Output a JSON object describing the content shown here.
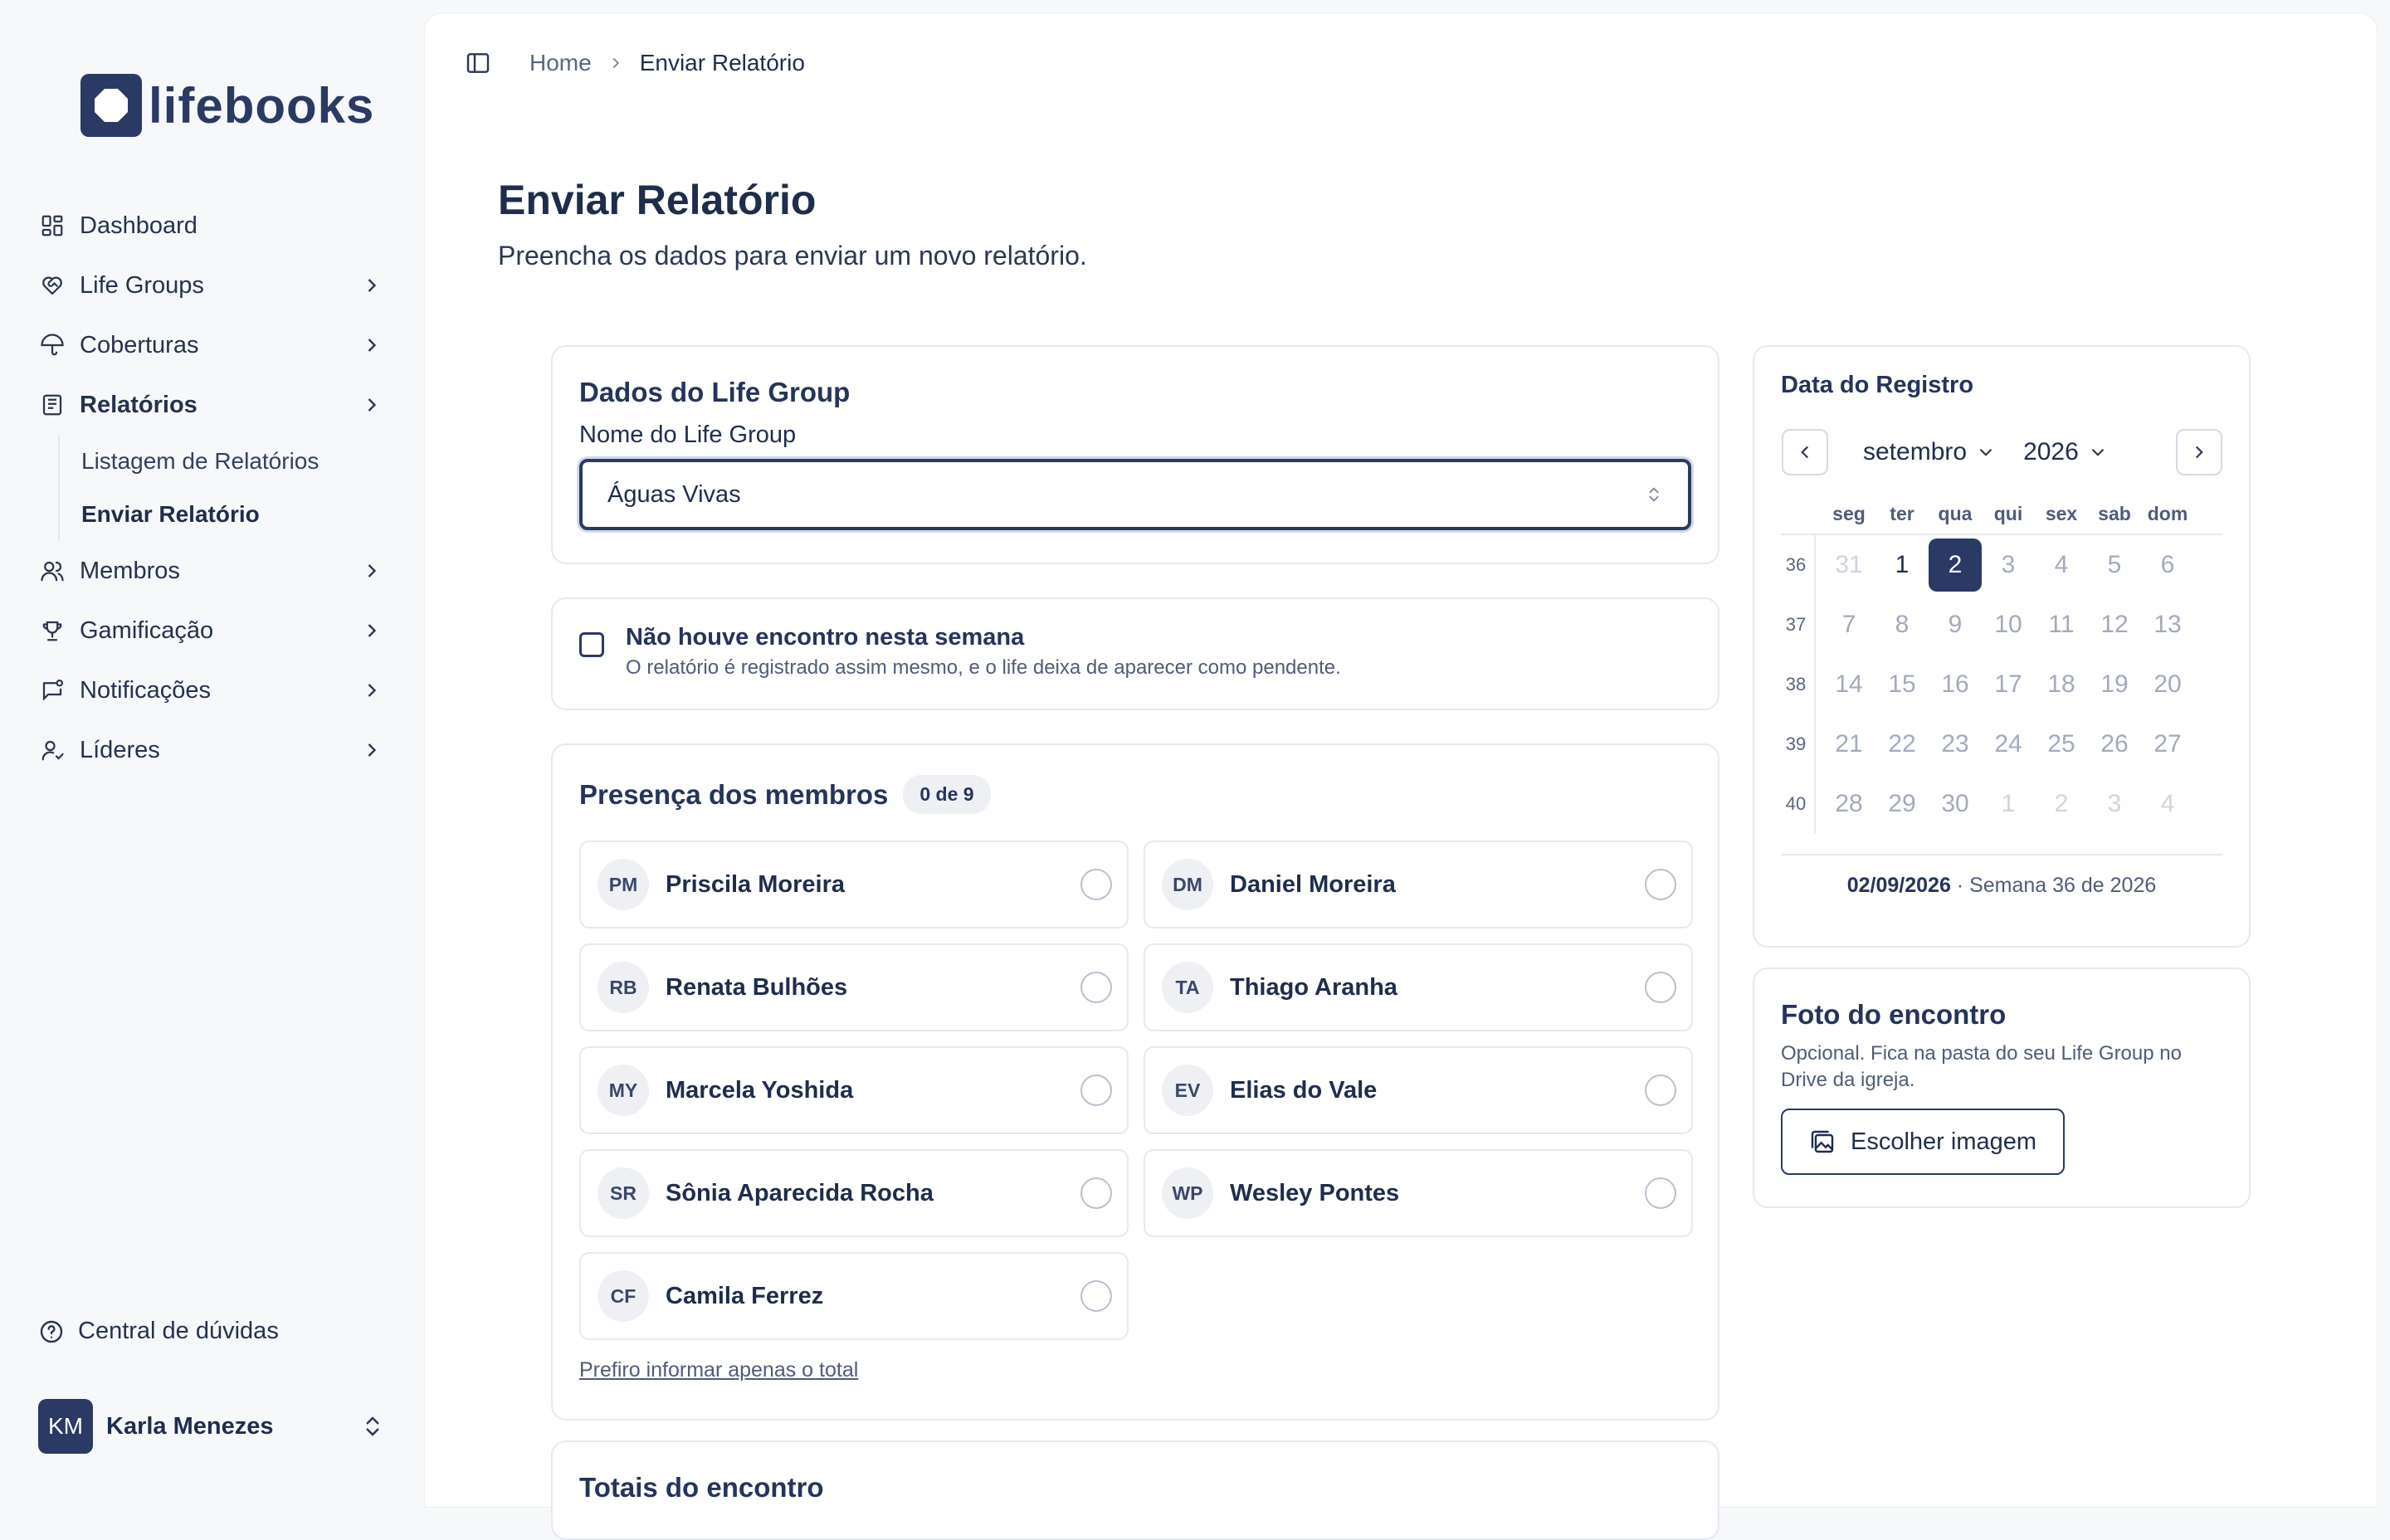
{
  "brand": {
    "name": "lifebooks"
  },
  "sidebar": {
    "items": [
      {
        "label": "Dashboard",
        "icon": "dashboard-icon",
        "chevron": false
      },
      {
        "label": "Life Groups",
        "icon": "heart-handshake-icon",
        "chevron": true
      },
      {
        "label": "Coberturas",
        "icon": "umbrella-icon",
        "chevron": true
      },
      {
        "label": "Relatórios",
        "icon": "report-icon",
        "chevron": true,
        "active": true
      },
      {
        "label": "Membros",
        "icon": "users-icon",
        "chevron": true
      },
      {
        "label": "Gamificação",
        "icon": "trophy-icon",
        "chevron": true
      },
      {
        "label": "Notificações",
        "icon": "notification-icon",
        "chevron": true
      },
      {
        "label": "Líderes",
        "icon": "leader-icon",
        "chevron": true
      }
    ],
    "subitems": [
      {
        "label": "Listagem de Relatórios"
      },
      {
        "label": "Enviar Relatório",
        "active": true
      }
    ],
    "help": "Central de dúvidas",
    "user": {
      "initials": "KM",
      "name": "Karla Menezes"
    }
  },
  "breadcrumb": {
    "home": "Home",
    "current": "Enviar Relatório"
  },
  "page": {
    "title": "Enviar Relatório",
    "subtitle": "Preencha os dados para enviar um novo relatório."
  },
  "lifegroup": {
    "title": "Dados do Life Group",
    "field_label": "Nome do Life Group",
    "selected": "Águas Vivas"
  },
  "no_meeting": {
    "title": "Não houve encontro nesta semana",
    "description": "O relatório é registrado assim mesmo, e o life deixa de aparecer como pendente.",
    "checked": false
  },
  "presence": {
    "title": "Presença dos membros",
    "count": "0 de 9",
    "members": [
      {
        "initials": "PM",
        "name": "Priscila Moreira"
      },
      {
        "initials": "DM",
        "name": "Daniel Moreira"
      },
      {
        "initials": "RB",
        "name": "Renata Bulhões"
      },
      {
        "initials": "TA",
        "name": "Thiago Aranha"
      },
      {
        "initials": "MY",
        "name": "Marcela Yoshida"
      },
      {
        "initials": "EV",
        "name": "Elias do Vale"
      },
      {
        "initials": "SR",
        "name": "Sônia Aparecida Rocha"
      },
      {
        "initials": "WP",
        "name": "Wesley Pontes"
      },
      {
        "initials": "CF",
        "name": "Camila Ferrez"
      }
    ],
    "total_link": "Prefiro informar apenas o total"
  },
  "totals": {
    "title": "Totais do encontro"
  },
  "calendar": {
    "title": "Data do Registro",
    "month": "setembro",
    "year": "2026",
    "weekdays": [
      "seg",
      "ter",
      "qua",
      "qui",
      "sex",
      "sab",
      "dom"
    ],
    "weeks": [
      {
        "num": "36",
        "days": [
          {
            "d": "31",
            "s": "muted"
          },
          {
            "d": "1",
            "s": "cur"
          },
          {
            "d": "2",
            "s": "sel"
          },
          {
            "d": "3",
            "s": ""
          },
          {
            "d": "4",
            "s": ""
          },
          {
            "d": "5",
            "s": ""
          },
          {
            "d": "6",
            "s": ""
          }
        ]
      },
      {
        "num": "37",
        "days": [
          {
            "d": "7",
            "s": ""
          },
          {
            "d": "8",
            "s": ""
          },
          {
            "d": "9",
            "s": ""
          },
          {
            "d": "10",
            "s": ""
          },
          {
            "d": "11",
            "s": ""
          },
          {
            "d": "12",
            "s": ""
          },
          {
            "d": "13",
            "s": ""
          }
        ]
      },
      {
        "num": "38",
        "days": [
          {
            "d": "14",
            "s": ""
          },
          {
            "d": "15",
            "s": ""
          },
          {
            "d": "16",
            "s": ""
          },
          {
            "d": "17",
            "s": ""
          },
          {
            "d": "18",
            "s": ""
          },
          {
            "d": "19",
            "s": ""
          },
          {
            "d": "20",
            "s": ""
          }
        ]
      },
      {
        "num": "39",
        "days": [
          {
            "d": "21",
            "s": ""
          },
          {
            "d": "22",
            "s": ""
          },
          {
            "d": "23",
            "s": ""
          },
          {
            "d": "24",
            "s": ""
          },
          {
            "d": "25",
            "s": ""
          },
          {
            "d": "26",
            "s": ""
          },
          {
            "d": "27",
            "s": ""
          }
        ]
      },
      {
        "num": "40",
        "days": [
          {
            "d": "28",
            "s": ""
          },
          {
            "d": "29",
            "s": ""
          },
          {
            "d": "30",
            "s": ""
          },
          {
            "d": "1",
            "s": "muted"
          },
          {
            "d": "2",
            "s": "muted"
          },
          {
            "d": "3",
            "s": "muted"
          },
          {
            "d": "4",
            "s": "muted"
          }
        ]
      }
    ],
    "footer_date": "02/09/2026",
    "footer_week": " · Semana 36 de 2026"
  },
  "photo": {
    "title": "Foto do encontro",
    "description": "Opcional. Fica na pasta do seu Life Group no Drive da igreja.",
    "button": "Escolher imagem"
  },
  "colors": {
    "primary": "#2a3a64",
    "text": "#1f2d4d",
    "border": "#e6e9ef"
  }
}
